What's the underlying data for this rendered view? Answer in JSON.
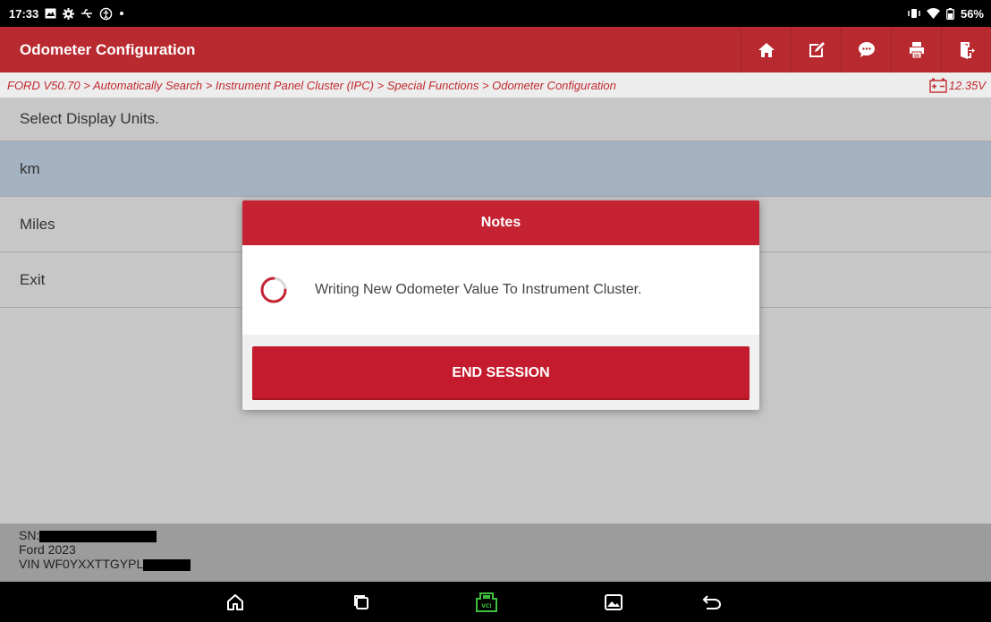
{
  "status_bar": {
    "time": "17:33",
    "battery_percent": "56%",
    "icons_left": [
      "gallery-icon",
      "settings-gear-icon",
      "usb-icon",
      "accessibility-icon",
      "dot-icon"
    ],
    "icons_right": [
      "vibrate-icon",
      "wifi-icon",
      "battery-icon"
    ]
  },
  "title_bar": {
    "title": "Odometer Configuration",
    "tools": [
      "home-icon",
      "edit-report-icon",
      "chat-icon",
      "print-icon",
      "exit-icon"
    ]
  },
  "breadcrumb": {
    "path": "FORD V50.70 > Automatically Search > Instrument Panel Cluster (IPC) > Special Functions > Odometer Configuration",
    "voltage": "12.35V"
  },
  "list": {
    "header": "Select Display Units.",
    "items": [
      {
        "label": "km",
        "selected": true
      },
      {
        "label": "Miles",
        "selected": false
      },
      {
        "label": "Exit",
        "selected": false
      }
    ]
  },
  "footer": {
    "sn_label": "SN:",
    "vehicle": "Ford  2023",
    "vin_label": "VIN WF0YXXTTGYPL"
  },
  "dialog": {
    "title": "Notes",
    "message": "Writing New Odometer Value To Instrument Cluster.",
    "button_label": "END SESSION"
  },
  "colors": {
    "brand_red": "#b82a30",
    "dialog_red": "#c52333",
    "selected_row": "#a4b2c2",
    "vci_green": "#3fbf3f"
  }
}
